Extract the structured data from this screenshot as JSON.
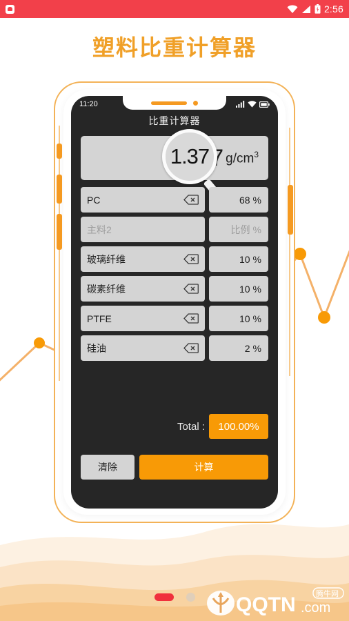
{
  "status_bar": {
    "time": "2:56",
    "app_icon": "app-icon",
    "icons": [
      "wifi-icon",
      "signal-icon",
      "battery-icon"
    ],
    "bg_color": "#f2404a"
  },
  "page": {
    "title": "塑料比重计算器",
    "title_color": "#f0a028"
  },
  "phone": {
    "status": {
      "time": "11:20",
      "icons": [
        "signal-icon",
        "wifi-icon",
        "battery-icon"
      ]
    },
    "header_title": "比重计算器",
    "result": {
      "value": "1.37",
      "magnified_value": "1.37",
      "unit": "g/cm",
      "unit_exponent": "3"
    },
    "rows": [
      {
        "name": "PC",
        "name_placeholder": "",
        "percent": "68",
        "percent_placeholder": "",
        "unit": "%",
        "clear_icon": "backspace-icon",
        "empty": false
      },
      {
        "name": "",
        "name_placeholder": "主料2",
        "percent": "",
        "percent_placeholder": "比例",
        "unit": "%",
        "clear_icon": "",
        "empty": true
      },
      {
        "name": "玻璃纤维",
        "name_placeholder": "",
        "percent": "10",
        "percent_placeholder": "",
        "unit": "%",
        "clear_icon": "backspace-icon",
        "empty": false
      },
      {
        "name": "碳素纤维",
        "name_placeholder": "",
        "percent": "10",
        "percent_placeholder": "",
        "unit": "%",
        "clear_icon": "backspace-icon",
        "empty": false
      },
      {
        "name": "PTFE",
        "name_placeholder": "",
        "percent": "10",
        "percent_placeholder": "",
        "unit": "%",
        "clear_icon": "backspace-icon",
        "empty": false
      },
      {
        "name": "硅油",
        "name_placeholder": "",
        "percent": "2",
        "percent_placeholder": "",
        "unit": "%",
        "clear_icon": "backspace-icon",
        "empty": false
      }
    ],
    "total": {
      "label": "Total :",
      "value": "100.00%",
      "badge_color": "#f89a06"
    },
    "buttons": {
      "clear": "清除",
      "calculate": "计算"
    }
  },
  "footer": {
    "page_indicator": {
      "active_index": 0,
      "count": 2,
      "active_color": "#f0303c"
    },
    "watermark": {
      "brand": "QQTN",
      "suffix": ".com",
      "badge": "腾牛网"
    }
  },
  "theme": {
    "accent": "#f89a06",
    "screen_bg": "#262626",
    "field_bg": "#d4d4d4"
  }
}
